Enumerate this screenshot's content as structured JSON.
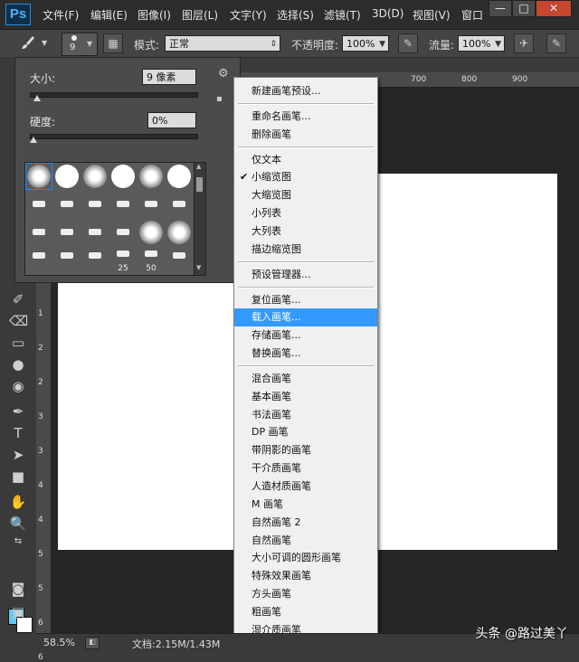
{
  "app": {
    "logo": "Ps"
  },
  "menubar": {
    "items": [
      "文件(F)",
      "编辑(E)",
      "图像(I)",
      "图层(L)",
      "文字(Y)",
      "选择(S)",
      "滤镜(T)",
      "3D(D)",
      "视图(V)",
      "窗口"
    ],
    "window_controls": {
      "minimize": "—",
      "maximize": "□",
      "close": "✕"
    }
  },
  "options": {
    "brush_size": "9",
    "mode_label": "模式:",
    "mode_value": "正常",
    "opacity_label": "不透明度:",
    "opacity_value": "100%",
    "flow_label": "流量:",
    "flow_value": "100%"
  },
  "brush_panel": {
    "size_label": "大小:",
    "size_value": "9 像素",
    "hardness_label": "硬度:",
    "hardness_value": "0%",
    "size_level": 0.02,
    "hardness_level": 0.0,
    "preset_numbers": [
      "25",
      "50"
    ]
  },
  "ruler": {
    "top_ticks": [
      "700",
      "800",
      "900"
    ],
    "left_ticks": [
      "0",
      "1",
      "1",
      "2",
      "2",
      "3",
      "3",
      "4",
      "4",
      "5",
      "5",
      "6",
      "6"
    ]
  },
  "context_menu": {
    "items": [
      {
        "label": "新建画笔预设..."
      },
      {
        "sep": true
      },
      {
        "label": "重命名画笔..."
      },
      {
        "label": "删除画笔"
      },
      {
        "sep": true
      },
      {
        "label": "仅文本"
      },
      {
        "label": "小缩览图",
        "checked": true
      },
      {
        "label": "大缩览图"
      },
      {
        "label": "小列表"
      },
      {
        "label": "大列表"
      },
      {
        "label": "描边缩览图"
      },
      {
        "sep": true
      },
      {
        "label": "预设管理器..."
      },
      {
        "sep": true
      },
      {
        "label": "复位画笔..."
      },
      {
        "label": "载入画笔...",
        "selected": true
      },
      {
        "label": "存储画笔..."
      },
      {
        "label": "替换画笔..."
      },
      {
        "sep": true
      },
      {
        "label": "混合画笔"
      },
      {
        "label": "基本画笔"
      },
      {
        "label": "书法画笔"
      },
      {
        "label": "DP 画笔"
      },
      {
        "label": "带阴影的画笔"
      },
      {
        "label": "干介质画笔"
      },
      {
        "label": "人造材质画笔"
      },
      {
        "label": "M 画笔"
      },
      {
        "label": "自然画笔 2"
      },
      {
        "label": "自然画笔"
      },
      {
        "label": "大小可调的圆形画笔"
      },
      {
        "label": "特殊效果画笔"
      },
      {
        "label": "方头画笔"
      },
      {
        "label": "粗画笔"
      },
      {
        "label": "湿介质画笔"
      }
    ]
  },
  "status": {
    "zoom": "58.5%",
    "doc": "文档:2.15M/1.43M"
  },
  "watermark": "头条 @路过美丫",
  "colors": {
    "foreground": "#5fc8f0",
    "background": "#ffffff",
    "menu_selected": "#3399ff"
  }
}
